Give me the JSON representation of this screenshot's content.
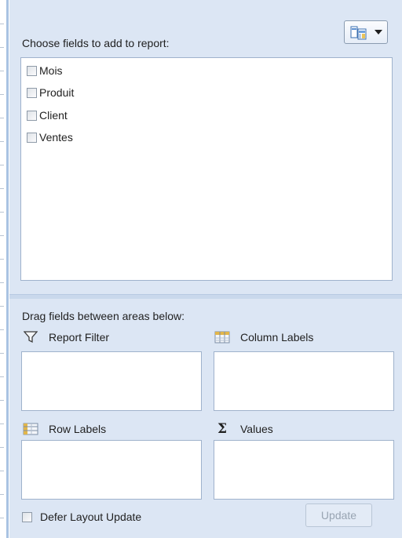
{
  "field_list": {
    "choose_label": "Choose fields to add to report:",
    "layout_button_icon": "field-list-layout-icon",
    "fields": [
      {
        "label": "Mois",
        "checked": false
      },
      {
        "label": "Produit",
        "checked": false
      },
      {
        "label": "Client",
        "checked": false
      },
      {
        "label": "Ventes",
        "checked": false
      }
    ]
  },
  "areas": {
    "drag_label": "Drag fields between areas below:",
    "report_filter": {
      "label": "Report Filter",
      "icon": "filter-funnel-icon"
    },
    "column_labels": {
      "label": "Column Labels",
      "icon": "column-grid-icon"
    },
    "row_labels": {
      "label": "Row Labels",
      "icon": "row-grid-icon"
    },
    "values": {
      "label": "Values",
      "icon": "sigma-icon"
    }
  },
  "footer": {
    "defer_label": "Defer Layout Update",
    "defer_checked": false,
    "update_label": "Update",
    "update_enabled": false
  },
  "colors": {
    "panel_bg": "#dce6f4",
    "border": "#9fb2cc",
    "accent_strip": "#a9c3e2",
    "disabled_text": "#98a4b2"
  }
}
